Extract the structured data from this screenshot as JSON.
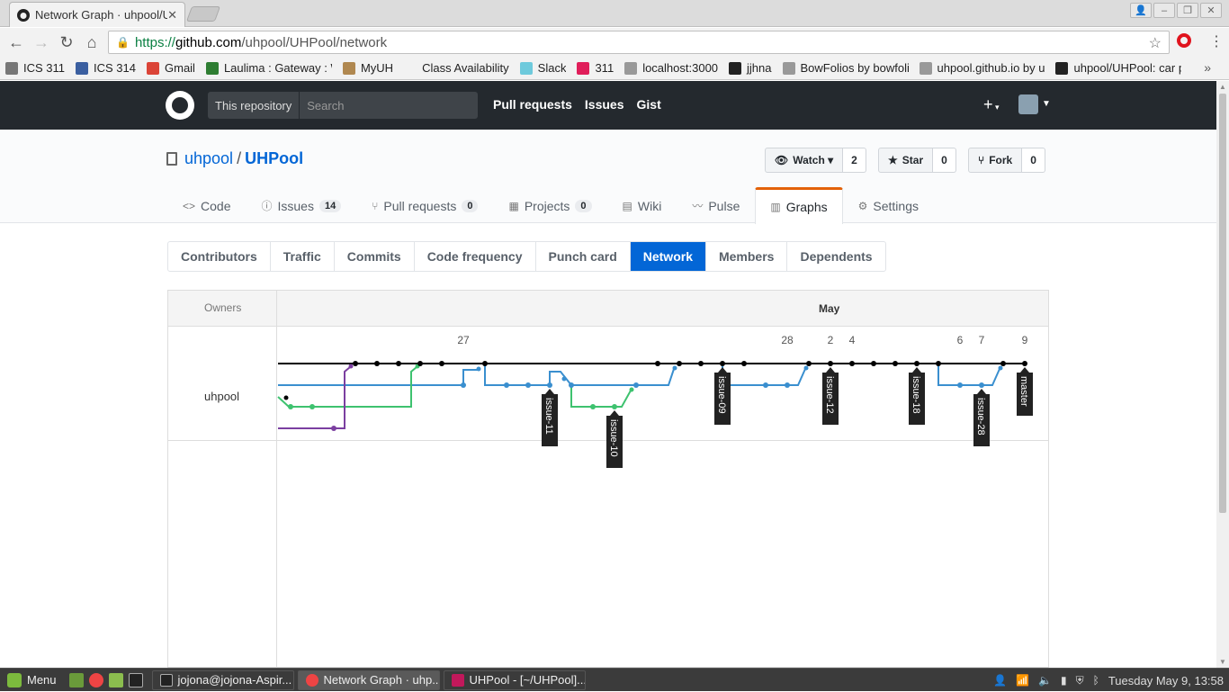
{
  "browser": {
    "tab_title": "Network Graph · uhpool/UHPool",
    "url_scheme": "https://",
    "url_host": "github.com",
    "url_path": "/uhpool/UHPool/network"
  },
  "bookmarks": [
    {
      "label": "ICS 311",
      "color": "#777"
    },
    {
      "label": "ICS 314",
      "color": "#3b5fa0"
    },
    {
      "label": "Gmail",
      "color": "#db4437"
    },
    {
      "label": "Laulima : Gateway : W",
      "color": "#2e7d32"
    },
    {
      "label": "MyUH",
      "color": "#b08850"
    },
    {
      "label": "Class Availability",
      "color": "transparent"
    },
    {
      "label": "Slack",
      "color": "#6ecadc"
    },
    {
      "label": "311",
      "color": "#e01e5a"
    },
    {
      "label": "localhost:3000",
      "color": "#999"
    },
    {
      "label": "jjhna",
      "color": "#222"
    },
    {
      "label": "BowFolios by bowfolio",
      "color": "#999"
    },
    {
      "label": "uhpool.github.io by u",
      "color": "#999"
    },
    {
      "label": "uhpool/UHPool: car p",
      "color": "#222"
    }
  ],
  "github": {
    "scope_label": "This repository",
    "search_placeholder": "Search",
    "nav": [
      "Pull requests",
      "Issues",
      "Gist"
    ],
    "plus": "+",
    "owner": "uhpool",
    "repo": "UHPool",
    "sep": "/",
    "actions": [
      {
        "label": "Watch ▾",
        "count": "2",
        "icon": "eye-icon"
      },
      {
        "label": "Star",
        "count": "0",
        "icon": "star-icon"
      },
      {
        "label": "Fork",
        "count": "0",
        "icon": "fork-icon"
      }
    ],
    "repo_tabs": [
      {
        "label": "Code",
        "counter": "",
        "icon": "code-icon"
      },
      {
        "label": "Issues",
        "counter": "14",
        "icon": "issue-icon"
      },
      {
        "label": "Pull requests",
        "counter": "0",
        "icon": "pr-icon"
      },
      {
        "label": "Projects",
        "counter": "0",
        "icon": "project-icon"
      },
      {
        "label": "Wiki",
        "counter": "",
        "icon": "book-icon"
      },
      {
        "label": "Pulse",
        "counter": "",
        "icon": "pulse-icon"
      },
      {
        "label": "Graphs",
        "counter": "",
        "icon": "graph-icon",
        "selected": true
      },
      {
        "label": "Settings",
        "counter": "",
        "icon": "gear-icon"
      }
    ],
    "graph_tabs": [
      "Contributors",
      "Traffic",
      "Commits",
      "Code frequency",
      "Punch card",
      "Network",
      "Members",
      "Dependents"
    ],
    "graph_selected": "Network"
  },
  "network": {
    "owners_header": "Owners",
    "month": "May",
    "owner": "uhpool",
    "date_labels": [
      "27",
      "28",
      "2",
      "4",
      "6",
      "7",
      "9"
    ],
    "branch_labels": [
      "issue-11",
      "issue-10",
      "issue-09",
      "issue-12",
      "issue-18",
      "issue-28",
      "master"
    ],
    "colors": {
      "master": "#000000",
      "blue": "#3a8fcf",
      "green": "#3ec26f",
      "purple": "#7b3fa0"
    }
  },
  "taskbar": {
    "menu": "Menu",
    "windows": [
      "jojona@jojona-Aspir...",
      "Network Graph · uhp...",
      "UHPool - [~/UHPool]..."
    ],
    "clock": "Tuesday May  9, 13:58"
  }
}
